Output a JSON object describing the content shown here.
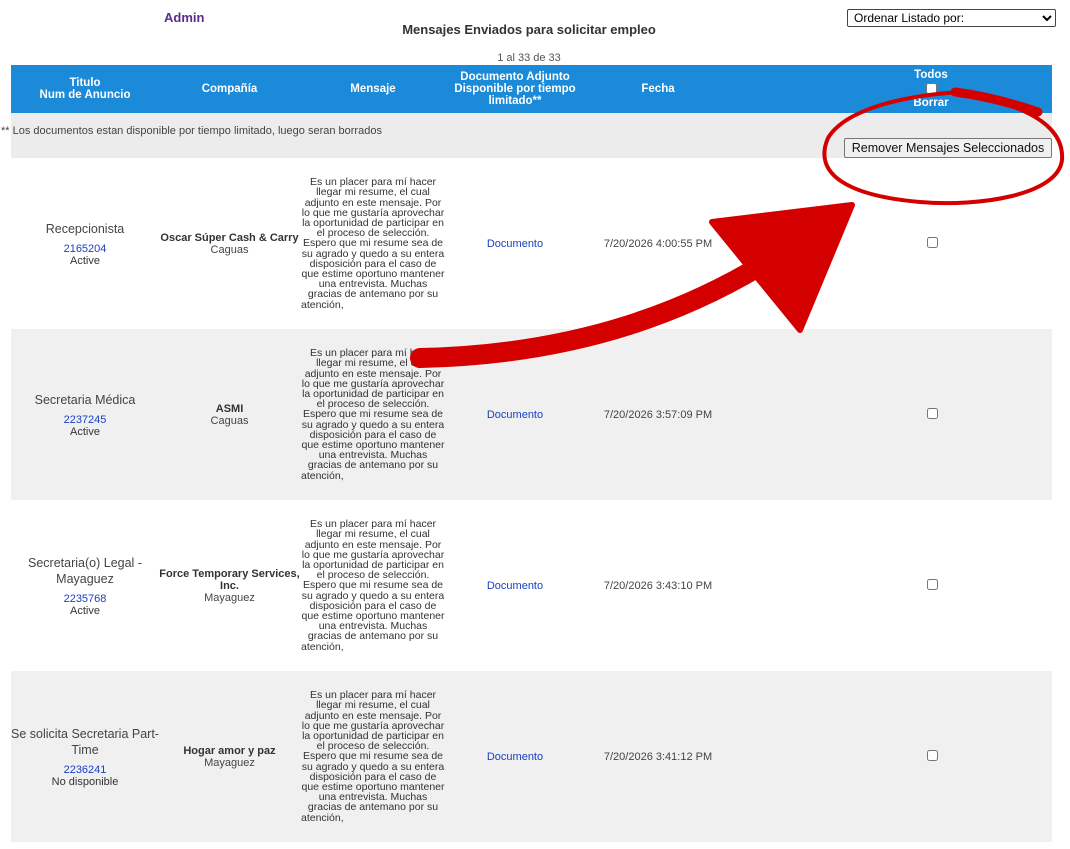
{
  "header": {
    "admin_label": "Admin",
    "page_title": "Mensajes Enviados para solicitar empleo",
    "sort_select": "Ordenar Listado por:",
    "pager": "1 al 33 de 33"
  },
  "columns": {
    "title_line1": "Titulo",
    "title_line2": "Num de Anuncio",
    "company": "Compañía",
    "message": "Mensaje",
    "doc_line1": "Documento Adjunto",
    "doc_line2": "Disponible por tiempo",
    "doc_line3": "limitado**",
    "date": "Fecha",
    "todos": "Todos",
    "borrar": "Borrar"
  },
  "note": "** Los documentos estan disponible por tiempo limitado, luego seran borrados",
  "remove_button": "Remover Mensajes Seleccionados",
  "message_lines": [
    "Es un placer para mí hacer",
    "llegar mi resume, el cual",
    "adjunto en este mensaje. Por",
    "lo que me gustaría aprovechar",
    "la oportunidad de participar en",
    "el proceso de selección.",
    "Espero que mi resume sea de",
    "su agrado y quedo a su entera",
    "disposición para el caso de",
    "que estime oportuno mantener",
    "una entrevista. Muchas",
    "gracias de antemano por su",
    "atención,"
  ],
  "rows": [
    {
      "title": "Recepcionista",
      "num": "2165204",
      "status": "Active",
      "company": "Oscar Súper Cash & Carry",
      "city": "Caguas",
      "doc": "Documento",
      "date": "7/20/2026 4:00:55 PM"
    },
    {
      "title": "Secretaria Médica",
      "num": "2237245",
      "status": "Active",
      "company": "ASMI",
      "city": "Caguas",
      "doc": "Documento",
      "date": "7/20/2026 3:57:09 PM"
    },
    {
      "title": "Secretaria(o) Legal - Mayaguez",
      "num": "2235768",
      "status": "Active",
      "company": "Force Temporary Services, Inc.",
      "city": "Mayaguez",
      "doc": "Documento",
      "date": "7/20/2026 3:43:10 PM"
    },
    {
      "title": "Se solicita Secretaria Part-Time",
      "num": "2236241",
      "status": "No disponible",
      "company": "Hogar amor y paz",
      "city": "Mayaguez",
      "doc": "Documento",
      "date": "7/20/2026 3:41:12 PM"
    }
  ],
  "colors": {
    "header_blue": "#1a8ad9",
    "admin_purple": "#5b2d8a",
    "link_blue": "#1a3fc4",
    "annotation_red": "#d40000"
  }
}
